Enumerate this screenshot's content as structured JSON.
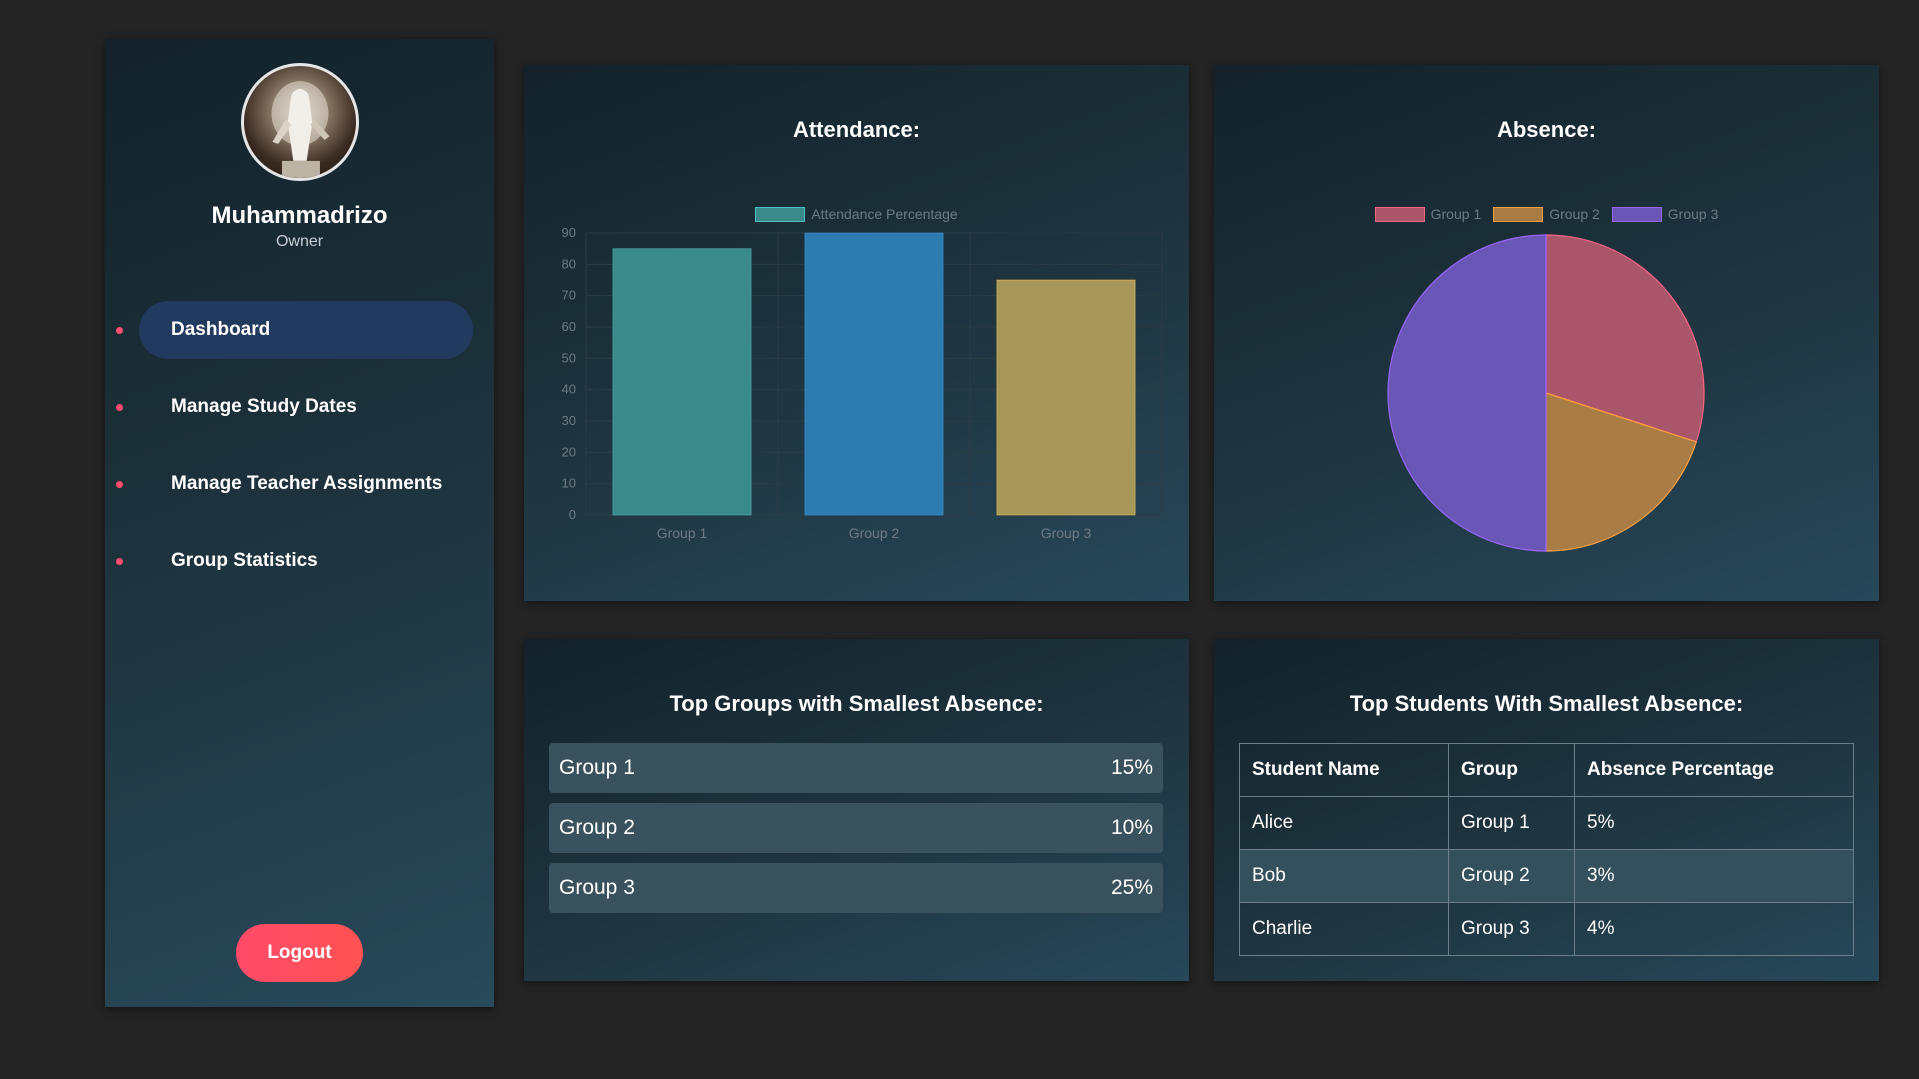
{
  "sidebar": {
    "user": {
      "name": "Muhammadrizo",
      "role": "Owner"
    },
    "nav": [
      {
        "label": "Dashboard",
        "active": true
      },
      {
        "label": "Manage Study Dates",
        "active": false
      },
      {
        "label": "Manage Teacher Assignments",
        "active": false
      },
      {
        "label": "Group Statistics",
        "active": false
      }
    ],
    "logout_label": "Logout"
  },
  "attendance": {
    "title": "Attendance:"
  },
  "absence": {
    "title": "Absence:"
  },
  "top_groups": {
    "title": "Top Groups with Smallest Absence:",
    "rows": [
      {
        "group": "Group 1",
        "value": "15%"
      },
      {
        "group": "Group 2",
        "value": "10%"
      },
      {
        "group": "Group 3",
        "value": "25%"
      }
    ]
  },
  "top_students": {
    "title": "Top Students With Smallest Absence:",
    "headers": [
      "Student Name",
      "Group",
      "Absence Percentage"
    ],
    "rows": [
      [
        "Alice",
        "Group 1",
        "5%"
      ],
      [
        "Bob",
        "Group 2",
        "3%"
      ],
      [
        "Charlie",
        "Group 3",
        "4%"
      ]
    ]
  },
  "chart_data": [
    {
      "type": "bar",
      "title": "",
      "categories": [
        "Group 1",
        "Group 2",
        "Group 3"
      ],
      "series": [
        {
          "name": "Attendance Percentage",
          "values": [
            85,
            90,
            75
          ]
        }
      ],
      "bar_colors": [
        "#3b8a8a",
        "#2e7bb0",
        "#a8975a"
      ],
      "bar_borders": [
        "#4bc0c0",
        "#36a2eb",
        "#ffce56"
      ],
      "ylim": [
        0,
        90
      ],
      "yticks": [
        0,
        10,
        20,
        30,
        40,
        50,
        60,
        70,
        80,
        90
      ],
      "grid": true,
      "legend": "top"
    },
    {
      "type": "pie",
      "title": "",
      "categories": [
        "Group 1",
        "Group 2",
        "Group 3"
      ],
      "values": [
        15,
        10,
        25
      ],
      "colors": [
        "#a9566b",
        "#a97c45",
        "#6a56b7"
      ],
      "borders": [
        "#ff6384",
        "#ff9f40",
        "#9966ff"
      ],
      "legend": "top"
    }
  ]
}
